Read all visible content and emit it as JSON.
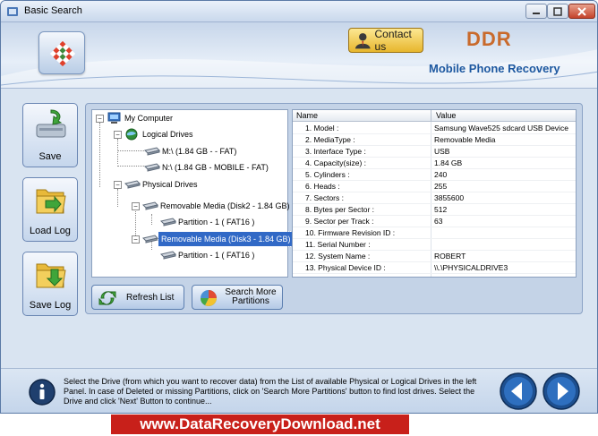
{
  "window": {
    "title": "Basic Search"
  },
  "header": {
    "contact_label": "Contact us",
    "brand": "DDR",
    "product": "Mobile Phone Recovery",
    "brand_color": "#c96a2c",
    "product_color": "#1d58a0"
  },
  "sidebar": {
    "items": [
      {
        "label": "Save",
        "icon": "save-disk-icon"
      },
      {
        "label": "Load Log",
        "icon": "load-log-folder-icon"
      },
      {
        "label": "Save Log",
        "icon": "save-log-folder-icon"
      }
    ]
  },
  "tree": {
    "root": "My Computer",
    "logical": "Logical Drives",
    "m_drive": "M:\\ (1.84 GB -  - FAT)",
    "n_drive": "N:\\ (1.84 GB - MOBILE - FAT)",
    "physical": "Physical Drives",
    "disk2": "Removable Media (Disk2 - 1.84 GB)",
    "disk2_part": "Partition - 1 ( FAT16 )",
    "disk3": "Removable Media (Disk3 - 1.84 GB)",
    "disk3_part": "Partition - 1 ( FAT16 )"
  },
  "grid": {
    "col_name": "Name",
    "col_value": "Value",
    "rows": [
      {
        "name": "1. Model :",
        "value": "Samsung Wave525 sdcard USB Device"
      },
      {
        "name": "2. MediaType :",
        "value": "Removable Media"
      },
      {
        "name": "3. Interface Type :",
        "value": "USB"
      },
      {
        "name": "4. Capacity(size) :",
        "value": "1.84 GB"
      },
      {
        "name": "5. Cylinders :",
        "value": "240"
      },
      {
        "name": "6. Heads :",
        "value": "255"
      },
      {
        "name": "7. Sectors :",
        "value": "3855600"
      },
      {
        "name": "8. Bytes per Sector :",
        "value": "512"
      },
      {
        "name": "9. Sector per Track :",
        "value": "63"
      },
      {
        "name": "10. Firmware Revision ID :",
        "value": ""
      },
      {
        "name": "11. Serial Number :",
        "value": ""
      },
      {
        "name": "12. System Name :",
        "value": "ROBERT"
      },
      {
        "name": "13. Physical Device ID :",
        "value": "\\\\.\\PHYSICALDRIVE3"
      }
    ]
  },
  "actions": {
    "refresh_label": "Refresh List",
    "search_more_label": "Search More Partitions"
  },
  "footer": {
    "help_text": "Select the Drive (from which you want to recover data) from the List of available Physical or Logical Drives in the left Panel. In case of Deleted or missing Partitions, click on 'Search More Partitions' button to find lost drives. Select the Drive and click 'Next' Button to continue..."
  },
  "banner": {
    "text": "www.DataRecoveryDownload.net",
    "color": "#c8201a"
  }
}
